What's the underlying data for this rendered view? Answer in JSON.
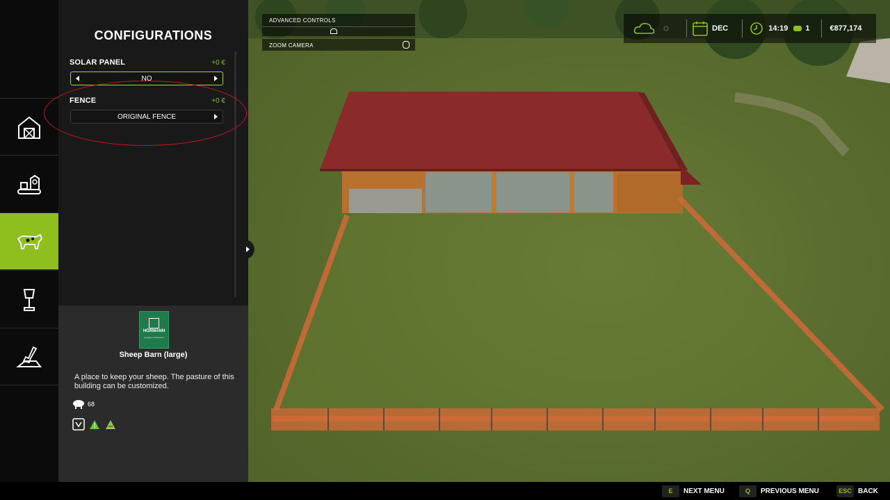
{
  "panel": {
    "title": "CONFIGURATIONS",
    "configs": [
      {
        "label": "SOLAR PANEL",
        "price": "+0 €",
        "value": "NO"
      },
      {
        "label": "FENCE",
        "price": "+0 €",
        "value": "ORIGINAL FENCE"
      }
    ]
  },
  "rail": {
    "items": [
      {
        "icon": "barn-icon"
      },
      {
        "icon": "production-icon"
      },
      {
        "icon": "cow-icon",
        "active": true
      },
      {
        "icon": "lamp-icon"
      },
      {
        "icon": "shovel-icon"
      }
    ]
  },
  "info": {
    "brand": "HÖRMANN",
    "brand_sub": "Garagen & Schwerter",
    "item_name": "Sheep Barn (large)",
    "description": "A place to keep your sheep. The pasture of this building can be customized.",
    "capacity": "68"
  },
  "hud": {
    "advanced_controls": "ADVANCED CONTROLS",
    "zoom_camera": "ZOOM CAMERA",
    "month": "DEC",
    "time": "14:19",
    "speed": "1",
    "money": "€877,174"
  },
  "bottom": {
    "next": {
      "key": "E",
      "label": "NEXT MENU"
    },
    "prev": {
      "key": "Q",
      "label": "PREVIOUS MENU"
    },
    "back": {
      "key": "ESC",
      "label": "BACK"
    }
  },
  "colors": {
    "accent": "#8fbf1e",
    "annotation": "#c8181c",
    "roof": "#8a2a2a",
    "fence": "#d06a3a"
  }
}
